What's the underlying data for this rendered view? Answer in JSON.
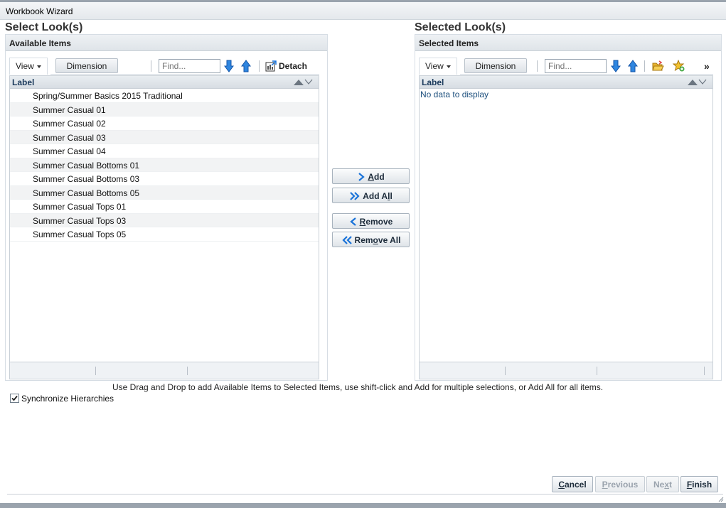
{
  "window": {
    "title": "Workbook Wizard"
  },
  "left": {
    "section_title": "Select Look(s)",
    "panel_title": "Available Items",
    "toolbar": {
      "view_label": "View",
      "dimension_label": "Dimension",
      "find_placeholder": "Find...",
      "detach_label": "Detach"
    },
    "column_header": "Label",
    "rows": [
      "Spring/Summer Basics 2015 Traditional",
      "Summer Casual 01",
      "Summer Casual 02",
      "Summer Casual 03",
      "Summer Casual 04",
      "Summer Casual Bottoms 01",
      "Summer Casual Bottoms 03",
      "Summer Casual Bottoms 05",
      "Summer Casual Tops 01",
      "Summer Casual Tops 03",
      "Summer Casual Tops 05"
    ]
  },
  "right": {
    "section_title": "Selected Look(s)",
    "panel_title": "Selected Items",
    "toolbar": {
      "view_label": "View",
      "dimension_label": "Dimension",
      "find_placeholder": "Find...",
      "overflow_label": "»"
    },
    "column_header": "Label",
    "empty_text": "No data to display"
  },
  "shuttle": {
    "add": {
      "first": "A",
      "rest": "dd"
    },
    "add_all": {
      "pre": "Add A",
      "u": "l",
      "post": "l"
    },
    "remove": {
      "first": "R",
      "rest": "emove"
    },
    "remove_all": {
      "pre": "Rem",
      "u": "o",
      "post": "ve All"
    }
  },
  "hint": "Use Drag and Drop to add Available Items to Selected Items, use shift-click and Add for multiple selections, or Add All for all items.",
  "sync": {
    "label": "Synchronize Hierarchies",
    "checked": true
  },
  "footer": {
    "cancel": {
      "first": "C",
      "rest": "ancel"
    },
    "previous": {
      "first": "P",
      "rest": "revious"
    },
    "next": {
      "first": "Ne",
      "u": "x",
      "rest": "t"
    },
    "finish": {
      "first": "F",
      "rest": "inish"
    }
  },
  "colors": {
    "accent_blue": "#1a73d9",
    "header_text": "#1b3a5c",
    "border": "#c9d0d7"
  }
}
